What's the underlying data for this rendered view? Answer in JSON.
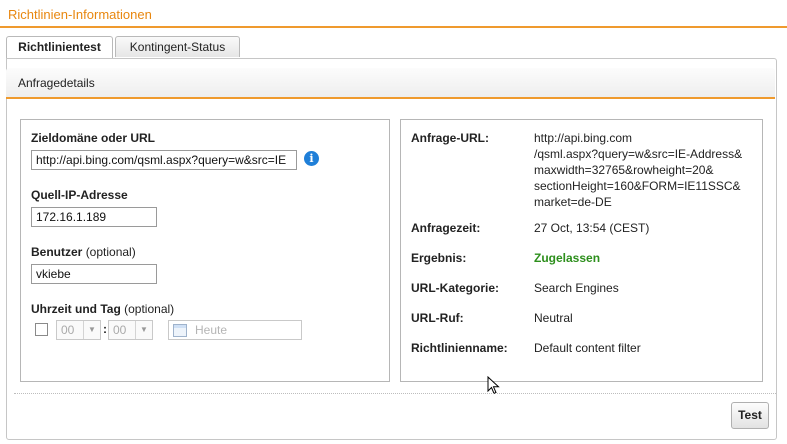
{
  "header": {
    "title": "Richtlinien-Informationen"
  },
  "tabs": [
    {
      "label": "Richtlinientest",
      "active": true
    },
    {
      "label": "Kontingent-Status",
      "active": false
    }
  ],
  "section": {
    "title": "Anfragedetails"
  },
  "form": {
    "url_label": "Zieldomäne oder URL",
    "url_value": "http://api.bing.com/qsml.aspx?query=w&src=IE",
    "ip_label": "Quell-IP-Adresse",
    "ip_value": "172.16.1.189",
    "user_label": "Benutzer",
    "user_optional": "(optional)",
    "user_value": "vkiebe",
    "time_label": "Uhrzeit und Tag",
    "time_optional": "(optional)",
    "hour_value": "00",
    "minute_value": "00",
    "date_placeholder": "Heute"
  },
  "result": {
    "request_url_label": "Anfrage-URL:",
    "request_url_lines": [
      "http://api.bing.com",
      "/qsml.aspx?query=w&src=IE-Address&",
      "maxwidth=32765&rowheight=20&",
      "sectionHeight=160&FORM=IE11SSC&",
      "market=de-DE"
    ],
    "time_label": "Anfragezeit:",
    "time_value": "27 Oct, 13:54 (CEST)",
    "result_label": "Ergebnis:",
    "result_value": "Zugelassen",
    "category_label": "URL-Kategorie:",
    "category_value": "Search Engines",
    "reputation_label": "URL-Ruf:",
    "reputation_value": "Neutral",
    "policy_label": "Richtlinienname:",
    "policy_value": "Default content filter"
  },
  "buttons": {
    "test_label": "Test"
  },
  "colors": {
    "accent": "#ef9a2e",
    "title": "#e8870f",
    "allowed": "#2d8f1c",
    "info": "#1f7fd8"
  },
  "icons": {
    "info": "info-icon",
    "calendar": "calendar-icon",
    "cursor": "mouse-pointer-icon"
  }
}
